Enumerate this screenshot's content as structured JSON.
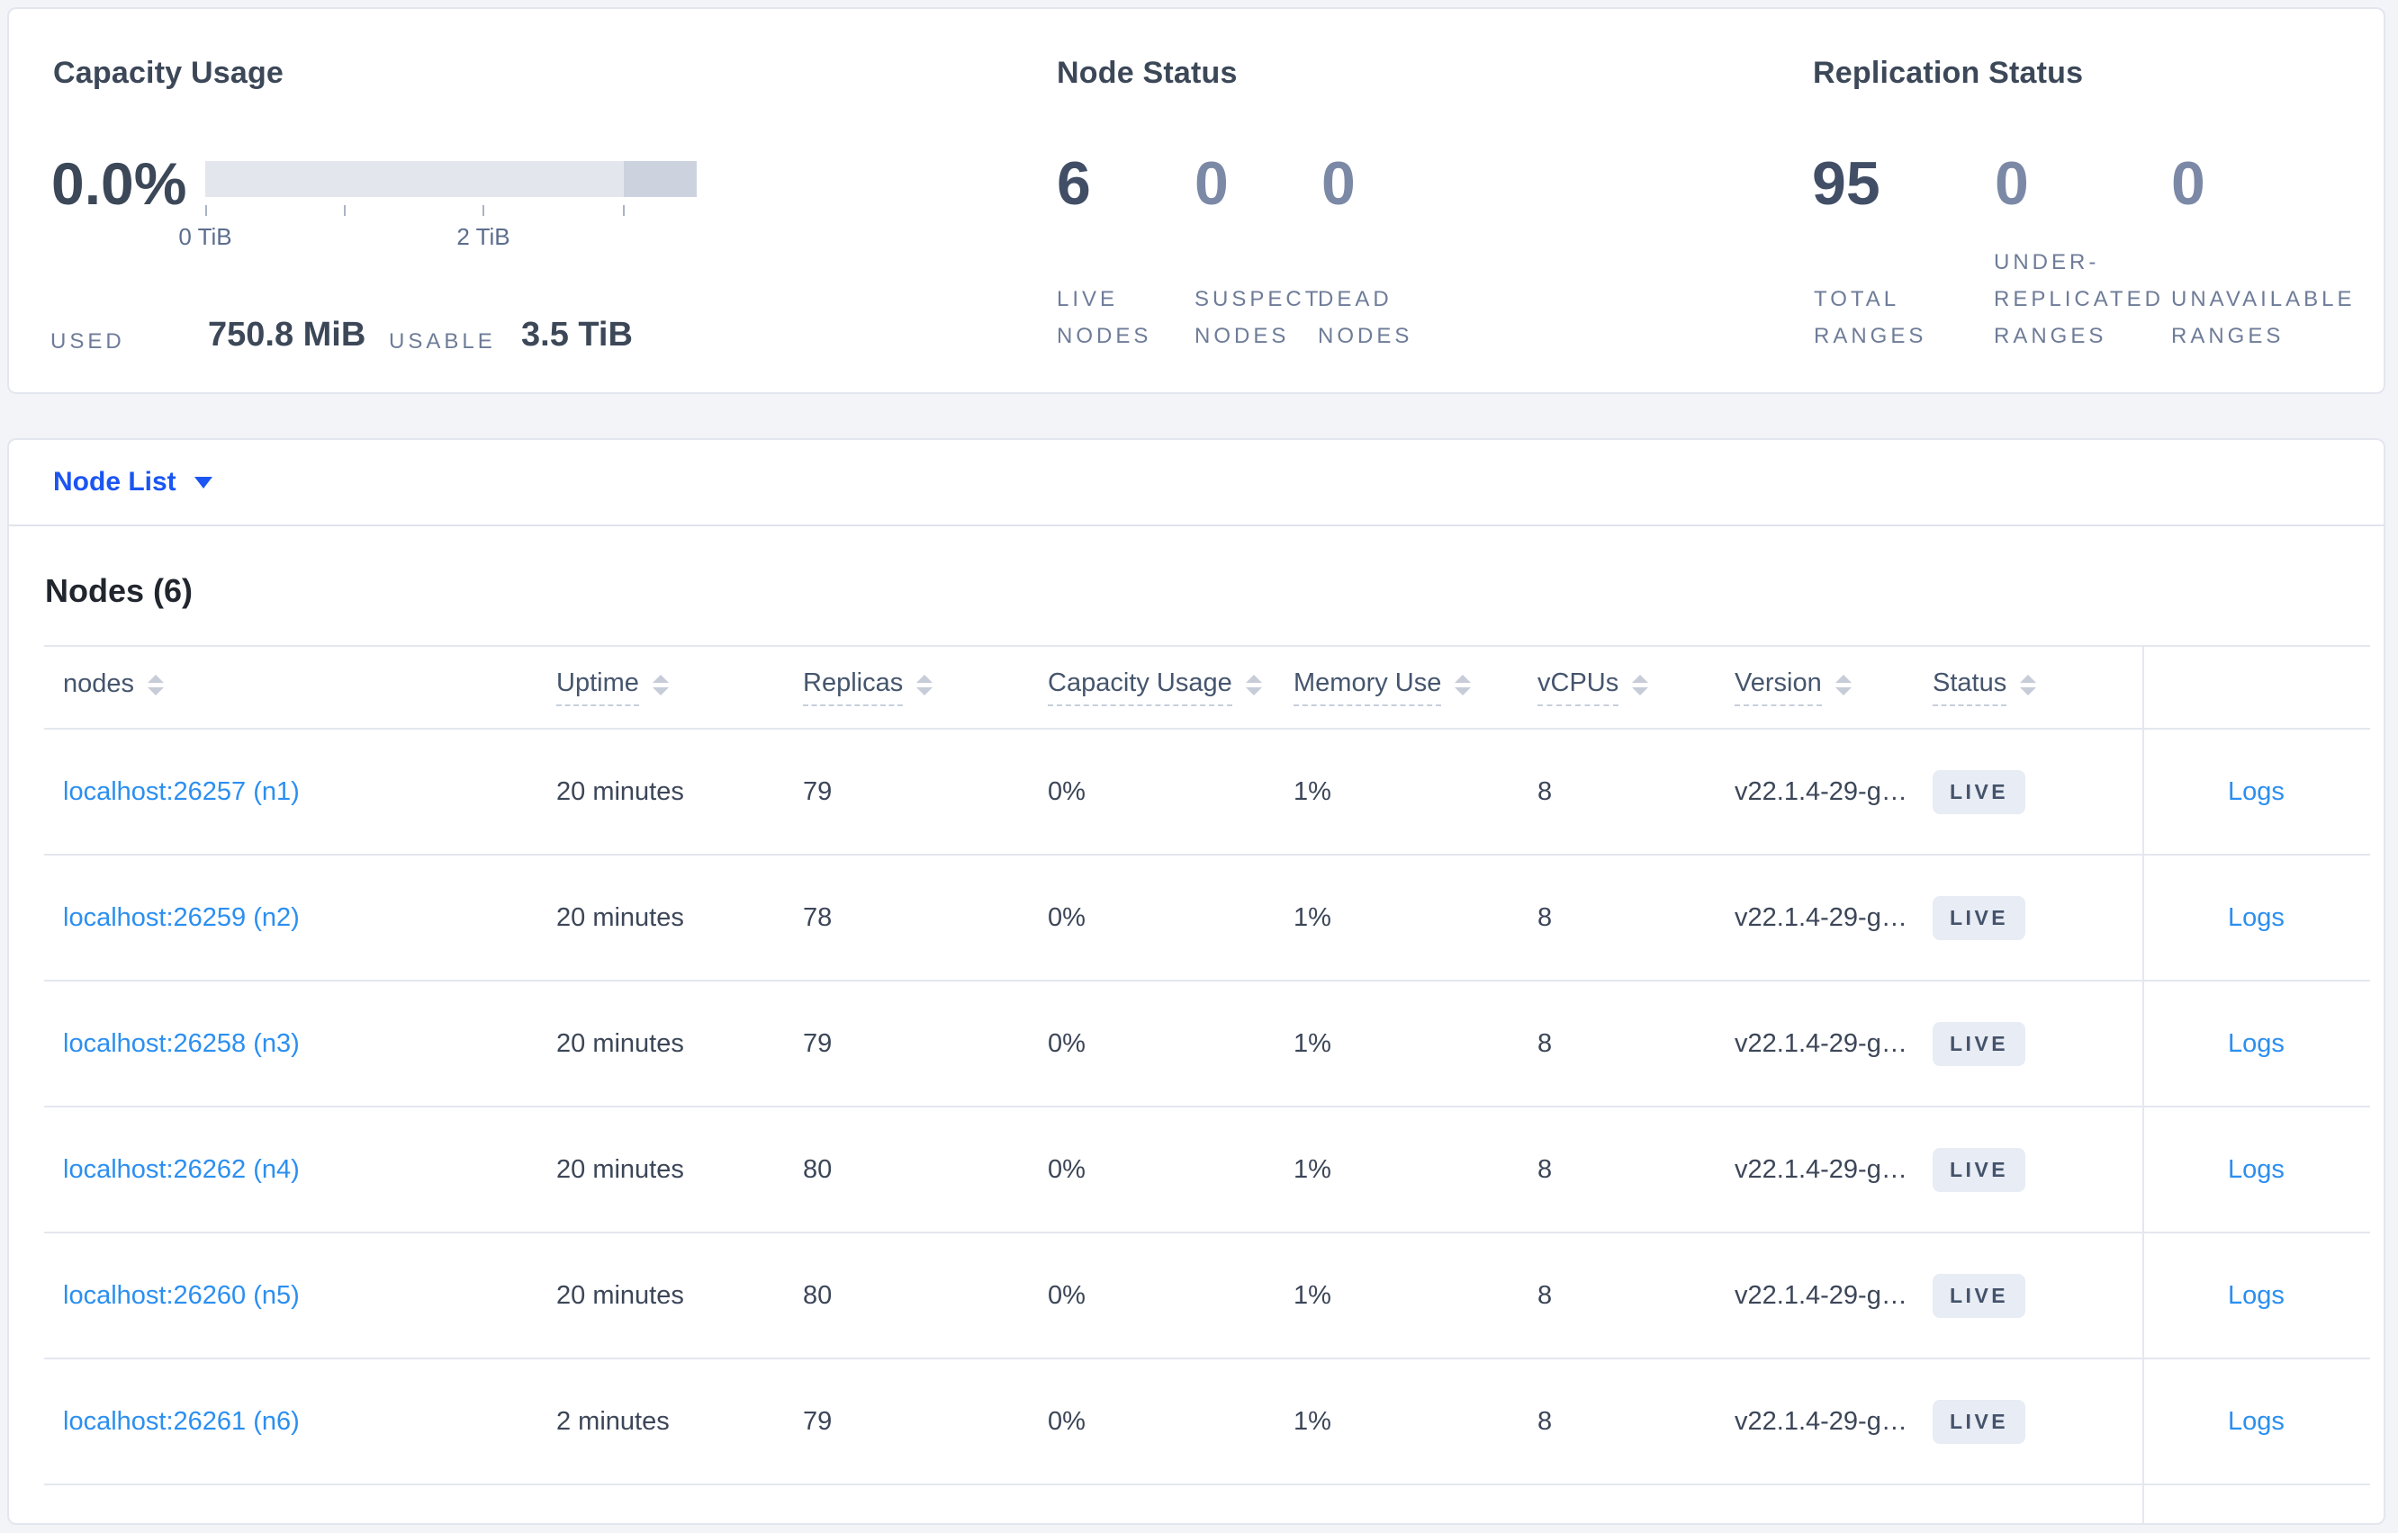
{
  "summary_card": {
    "capacity": {
      "title": "Capacity Usage",
      "percent": "0.0%",
      "tick_labels": {
        "zero": "0 TiB",
        "two": "2 TiB"
      },
      "used_label": "USED",
      "used_value": "750.8 MiB",
      "usable_label": "USABLE",
      "usable_value": "3.5 TiB"
    },
    "node_status": {
      "title": "Node Status",
      "live": {
        "value": "6",
        "label": "LIVE\nNODES"
      },
      "suspect": {
        "value": "0",
        "label": "SUSPECT\nNODES"
      },
      "dead": {
        "value": "0",
        "label": "DEAD\nNODES"
      }
    },
    "replication": {
      "title": "Replication Status",
      "total": {
        "value": "95",
        "label": "TOTAL\nRANGES"
      },
      "under_replicated": {
        "value": "0",
        "label": "UNDER-\nREPLICATED\nRANGES"
      },
      "unavailable": {
        "value": "0",
        "label": "UNAVAILABLE\nRANGES"
      }
    }
  },
  "nav": {
    "dropdown_label": "Node List"
  },
  "nodes_table": {
    "title": "Nodes (6)",
    "headers": {
      "nodes": "nodes",
      "uptime": "Uptime",
      "replicas": "Replicas",
      "capacity": "Capacity Usage",
      "memory": "Memory Use",
      "vcpus": "vCPUs",
      "version": "Version",
      "status": "Status"
    },
    "logs_label": "Logs",
    "rows": [
      {
        "node": "localhost:26257 (n1)",
        "uptime": "20 minutes",
        "replicas": "79",
        "capacity": "0%",
        "memory": "1%",
        "vcpus": "8",
        "version": "v22.1.4-29-g…",
        "status": "LIVE",
        "logs": "Logs"
      },
      {
        "node": "localhost:26259 (n2)",
        "uptime": "20 minutes",
        "replicas": "78",
        "capacity": "0%",
        "memory": "1%",
        "vcpus": "8",
        "version": "v22.1.4-29-g…",
        "status": "LIVE",
        "logs": "Logs"
      },
      {
        "node": "localhost:26258 (n3)",
        "uptime": "20 minutes",
        "replicas": "79",
        "capacity": "0%",
        "memory": "1%",
        "vcpus": "8",
        "version": "v22.1.4-29-g…",
        "status": "LIVE",
        "logs": "Logs"
      },
      {
        "node": "localhost:26262 (n4)",
        "uptime": "20 minutes",
        "replicas": "80",
        "capacity": "0%",
        "memory": "1%",
        "vcpus": "8",
        "version": "v22.1.4-29-g…",
        "status": "LIVE",
        "logs": "Logs"
      },
      {
        "node": "localhost:26260 (n5)",
        "uptime": "20 minutes",
        "replicas": "80",
        "capacity": "0%",
        "memory": "1%",
        "vcpus": "8",
        "version": "v22.1.4-29-g…",
        "status": "LIVE",
        "logs": "Logs"
      },
      {
        "node": "localhost:26261 (n6)",
        "uptime": "2 minutes",
        "replicas": "79",
        "capacity": "0%",
        "memory": "1%",
        "vcpus": "8",
        "version": "v22.1.4-29-g…",
        "status": "LIVE",
        "logs": "Logs"
      }
    ]
  },
  "colors": {
    "nav_blue": "#1b55f2",
    "link_blue": "#2b8ff0",
    "badge_bg": "#e8ecf4",
    "bar_light": "#e3e6ed",
    "bar_dark": "#ccd2de",
    "page_bg": "#f3f4f8"
  }
}
